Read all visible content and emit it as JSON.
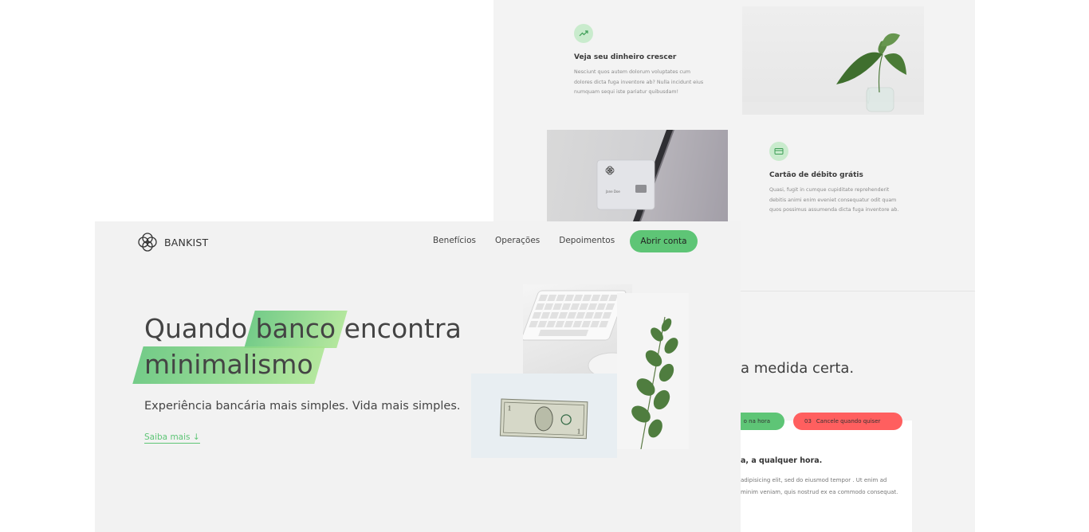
{
  "back": {
    "features": [
      {
        "icon": "trending-up-icon",
        "title": "Veja seu dinheiro crescer",
        "text": "Nesciunt quos autem dolorum voluptates cum dolores dicta fuga inventore ab? Nulla incidunt eius numquam sequi iste pariatur quibusdam!"
      },
      {
        "icon": "credit-card-icon",
        "title": "Cartão de débito grátis",
        "text": "Quasi, fugit in cumque cupiditate reprehenderit debitis animi enim eveniet consequatur odit quam quos possimus assumenda dicta fuga inventore ab."
      }
    ],
    "card_name": "Jane Doe",
    "section_title": "a medida certa.",
    "operations": {
      "tabs": [
        {
          "number": "",
          "label": "o na hora",
          "color": "#5ec576"
        },
        {
          "number": "03",
          "label": "Cancele quando quiser",
          "color": "#ff5f5f"
        }
      ],
      "panel_title": "a, a qualquer hora.",
      "panel_text": "adipisicing elit, sed do eiusmod tempor . Ut enim ad minim veniam, quis nostrud ex ea commodo consequat."
    }
  },
  "front": {
    "brand": "BANKIST",
    "nav": [
      "Benefícios",
      "Operações",
      "Depoimentos"
    ],
    "cta": "Abrir conta",
    "hero": {
      "title_part1": "Quando",
      "title_highlight1": "banco",
      "title_part2": "encontra",
      "title_highlight2": "minimalismo",
      "subtitle": "Experiência bancária mais simples. Vida mais simples.",
      "link": "Saiba mais ↓"
    }
  },
  "colors": {
    "green": "#5ec576",
    "red": "#ff5f5f",
    "background": "#f2f2f2"
  }
}
